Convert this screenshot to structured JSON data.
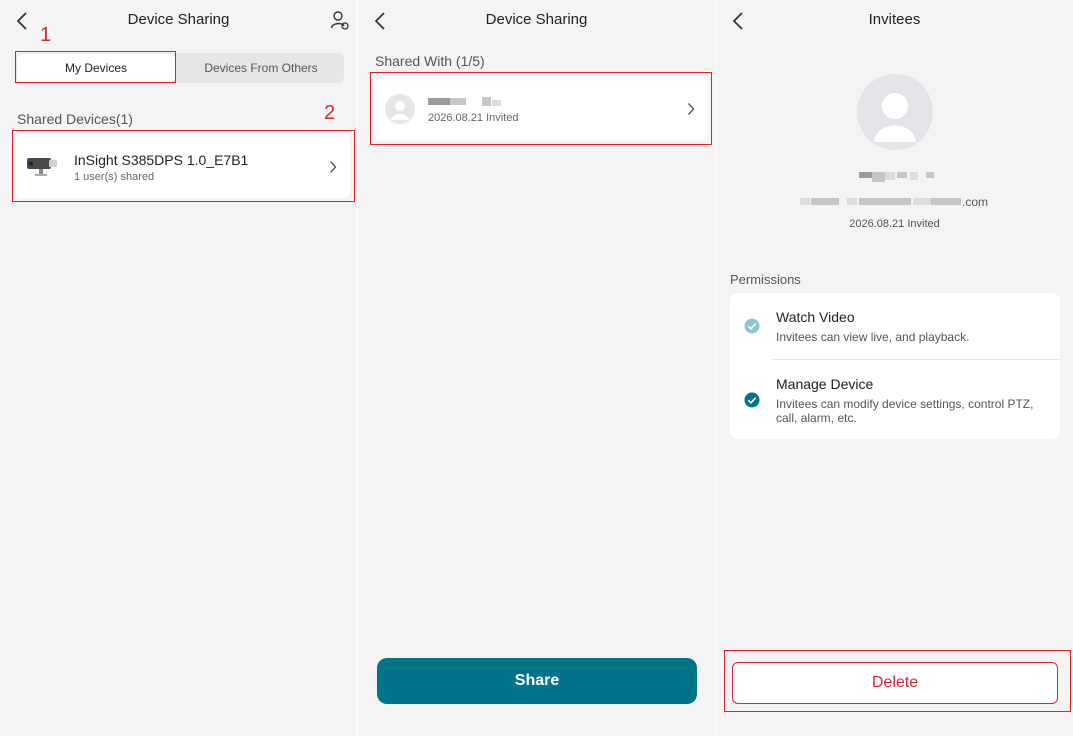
{
  "panel1": {
    "title": "Device Sharing",
    "step1": "1",
    "step2": "2",
    "tabs": {
      "my_devices": "My Devices",
      "from_others": "Devices From Others"
    },
    "section_label": "Shared Devices(1)",
    "device": {
      "name": "InSight S385DPS 1.0_E7B1",
      "subtitle": "1 user(s) shared"
    }
  },
  "panel2": {
    "title": "Device Sharing",
    "section_label": "Shared With (1/5)",
    "invitee": {
      "status": "2026.08.21 Invited"
    },
    "share_button": "Share"
  },
  "panel3": {
    "title": "Invitees",
    "email_suffix": ".com",
    "status": "2026.08.21 Invited",
    "permissions_label": "Permissions",
    "permissions": [
      {
        "title": "Watch Video",
        "desc": "Invitees can view live, and playback."
      },
      {
        "title": "Manage Device",
        "desc": "Invitees can modify device settings, control PTZ, call, alarm, etc."
      }
    ],
    "delete_button": "Delete"
  },
  "colors": {
    "accent": "#00758a",
    "annotation_red": "#e0212b",
    "delete_text": "#e0213a",
    "check_light": "#8cc5d0"
  },
  "icons": [
    "back-chevron-icon",
    "user-settings-icon",
    "chevron-right-icon",
    "camera-icon",
    "avatar-icon",
    "check-circle-icon"
  ]
}
